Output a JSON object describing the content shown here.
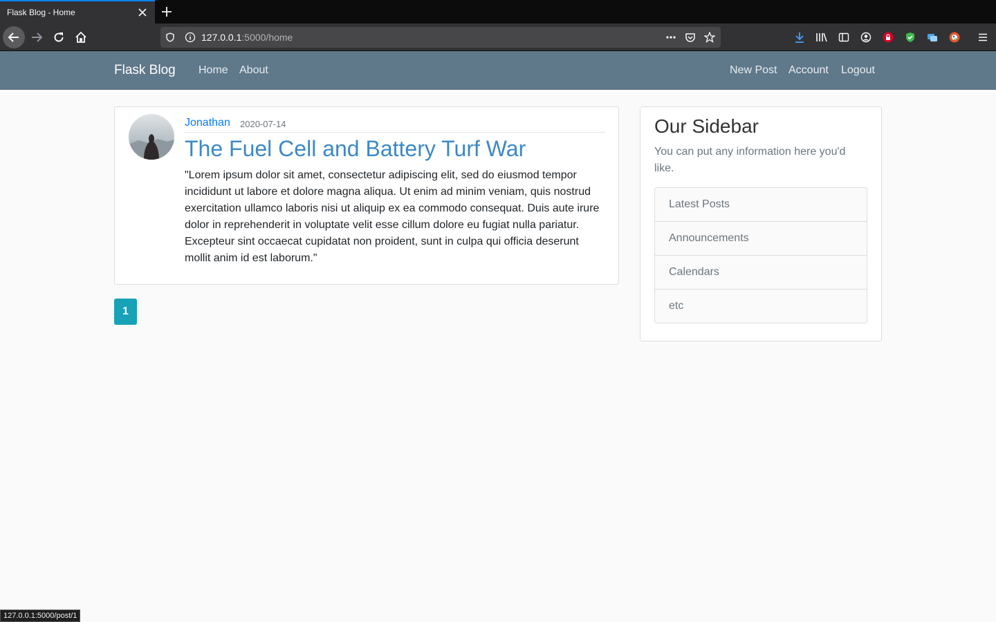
{
  "browser": {
    "tab_title": "Flask Blog - Home",
    "url_host": "127.0.0.1",
    "url_rest": ":5000/home",
    "status_url": "127.0.0.1:5000/post/1"
  },
  "navbar": {
    "brand": "Flask Blog",
    "left_links": [
      "Home",
      "About"
    ],
    "right_links": [
      "New Post",
      "Account",
      "Logout"
    ]
  },
  "post": {
    "author": "Jonathan",
    "date": "2020-07-14",
    "title": "The Fuel Cell and Battery Turf War",
    "body": "\"Lorem ipsum dolor sit amet, consectetur adipiscing elit, sed do eiusmod tempor incididunt ut labore et dolore magna aliqua. Ut enim ad minim veniam, quis nostrud exercitation ullamco laboris nisi ut aliquip ex ea commodo consequat. Duis aute irure dolor in reprehenderit in voluptate velit esse cillum dolore eu fugiat nulla pariatur. Excepteur sint occaecat cupidatat non proident, sunt in culpa qui officia deserunt mollit anim id est laborum.\""
  },
  "pagination": {
    "current": "1"
  },
  "sidebar": {
    "title": "Our Sidebar",
    "text": "You can put any information here you'd like.",
    "items": [
      "Latest Posts",
      "Announcements",
      "Calendars",
      "etc"
    ]
  },
  "colors": {
    "navbar": "#5f788a",
    "link": "#007bff",
    "title": "#3c89c6",
    "page_button": "#17a2b8"
  }
}
